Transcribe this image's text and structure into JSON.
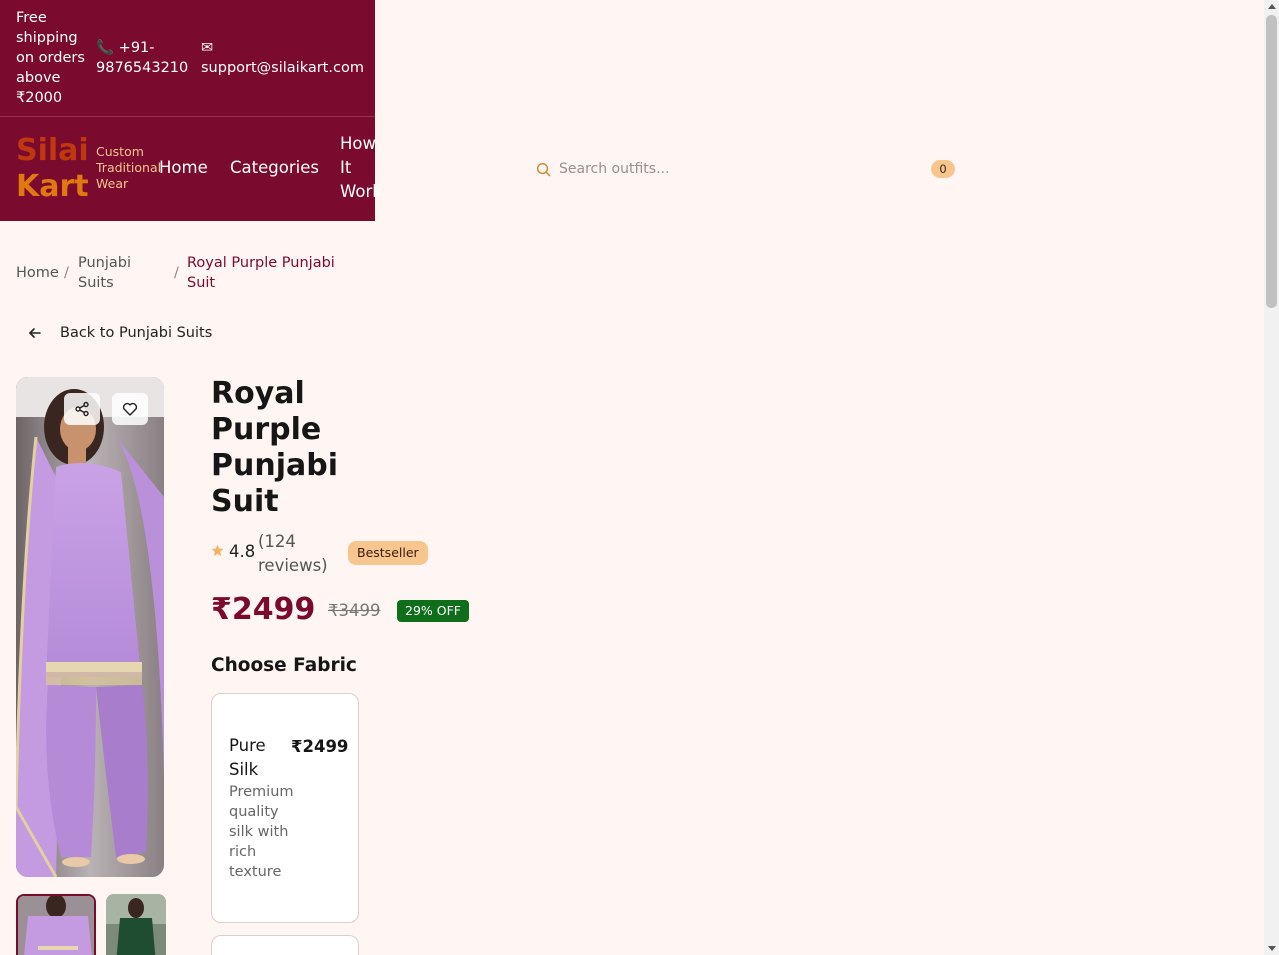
{
  "topbar": {
    "shipping": "Free shipping on orders above ₹2000",
    "phone": "📞 +91-9876543210",
    "email": "✉ support@silaikart.com"
  },
  "brand": {
    "name_part1": "Silai",
    "name_part2": "Kart",
    "tagline": "Custom Traditional Wear"
  },
  "nav": {
    "home": "Home",
    "categories": "Categories",
    "how_it_works": "How It Works"
  },
  "search": {
    "placeholder": "Search outfits..."
  },
  "cart": {
    "count": "0"
  },
  "breadcrumb": {
    "home": "Home",
    "sep": "/",
    "category": "Punjabi Suits",
    "current": "Royal Purple Punjabi Suit"
  },
  "back_link": "Back to Punjabi Suits",
  "product": {
    "title": "Royal Purple Punjabi Suit",
    "rating": "4.8",
    "reviews": "(124 reviews)",
    "badge": "Bestseller",
    "price": "₹2499",
    "old_price": "₹3499",
    "discount": "29% OFF"
  },
  "fabric": {
    "heading": "Choose Fabric",
    "options": [
      {
        "name": "Pure Silk",
        "price": "₹2499",
        "description": "Premium quality silk with rich texture"
      }
    ]
  },
  "colors": {
    "brand_maroon": "#7a0a2e",
    "accent_peach": "#f6c68e",
    "discount_green": "#0f6e1a"
  }
}
